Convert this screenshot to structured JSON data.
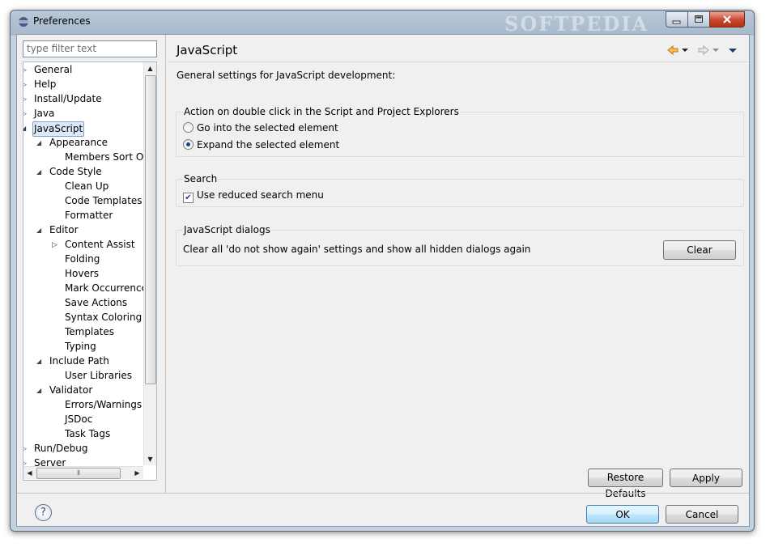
{
  "window": {
    "title": "Preferences",
    "watermark": "SOFTPEDIA"
  },
  "filter": {
    "placeholder": "type filter text"
  },
  "tree": [
    {
      "label": "General",
      "depth": 0,
      "arrow": "closed"
    },
    {
      "label": "Help",
      "depth": 0,
      "arrow": "closed"
    },
    {
      "label": "Install/Update",
      "depth": 0,
      "arrow": "closed"
    },
    {
      "label": "Java",
      "depth": 0,
      "arrow": "closed"
    },
    {
      "label": "JavaScript",
      "depth": 0,
      "arrow": "open",
      "selected": true
    },
    {
      "label": "Appearance",
      "depth": 1,
      "arrow": "open"
    },
    {
      "label": "Members Sort O",
      "depth": 2,
      "arrow": "none"
    },
    {
      "label": "Code Style",
      "depth": 1,
      "arrow": "open"
    },
    {
      "label": "Clean Up",
      "depth": 2,
      "arrow": "none"
    },
    {
      "label": "Code Templates",
      "depth": 2,
      "arrow": "none"
    },
    {
      "label": "Formatter",
      "depth": 2,
      "arrow": "none"
    },
    {
      "label": "Editor",
      "depth": 1,
      "arrow": "open"
    },
    {
      "label": "Content Assist",
      "depth": 2,
      "arrow": "closed"
    },
    {
      "label": "Folding",
      "depth": 2,
      "arrow": "none"
    },
    {
      "label": "Hovers",
      "depth": 2,
      "arrow": "none"
    },
    {
      "label": "Mark Occurrence",
      "depth": 2,
      "arrow": "none"
    },
    {
      "label": "Save Actions",
      "depth": 2,
      "arrow": "none"
    },
    {
      "label": "Syntax Coloring",
      "depth": 2,
      "arrow": "none"
    },
    {
      "label": "Templates",
      "depth": 2,
      "arrow": "none"
    },
    {
      "label": "Typing",
      "depth": 2,
      "arrow": "none"
    },
    {
      "label": "Include Path",
      "depth": 1,
      "arrow": "open"
    },
    {
      "label": "User Libraries",
      "depth": 2,
      "arrow": "none"
    },
    {
      "label": "Validator",
      "depth": 1,
      "arrow": "open"
    },
    {
      "label": "Errors/Warnings",
      "depth": 2,
      "arrow": "none"
    },
    {
      "label": "JSDoc",
      "depth": 2,
      "arrow": "none"
    },
    {
      "label": "Task Tags",
      "depth": 2,
      "arrow": "none"
    },
    {
      "label": "Run/Debug",
      "depth": 0,
      "arrow": "closed"
    },
    {
      "label": "Server",
      "depth": 0,
      "arrow": "closed"
    }
  ],
  "page": {
    "title": "JavaScript",
    "description": "General settings for JavaScript development:",
    "double_click_group": {
      "title": "Action on double click in the Script and Project Explorers",
      "options": [
        "Go into the selected element",
        "Expand the selected element"
      ],
      "selected_index": 1
    },
    "search_group": {
      "title": "Search",
      "checkbox_label": "Use reduced search menu",
      "checked": true
    },
    "dialogs_group": {
      "title": "JavaScript dialogs",
      "text": "Clear all 'do not show again' settings and show all hidden dialogs again",
      "clear_label": "Clear"
    },
    "restore_defaults_label": "Restore Defaults",
    "apply_label": "Apply"
  },
  "footer": {
    "ok_label": "OK",
    "cancel_label": "Cancel"
  },
  "icons": {
    "back": "back-arrow-icon",
    "forward": "forward-arrow-icon",
    "menu": "view-menu-icon",
    "help": "help-icon"
  },
  "colors": {
    "accent_orange": "#e8a020",
    "selection_bg": "#dce9f7"
  }
}
